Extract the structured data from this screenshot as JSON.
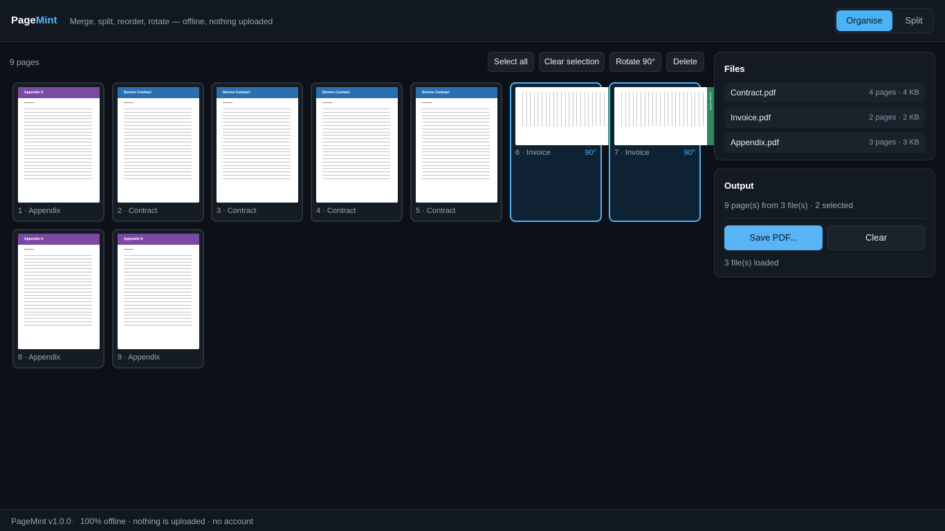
{
  "header": {
    "brand_part1": "Page",
    "brand_part2": "Mint",
    "tagline": "Merge, split, reorder, rotate — offline, nothing uploaded",
    "modes": [
      "Organise",
      "Split"
    ],
    "active_mode": "Organise"
  },
  "toolbar": {
    "page_count": "9 pages",
    "buttons": [
      "Select all",
      "Clear selection",
      "Rotate 90°",
      "Delete"
    ]
  },
  "thumbnails": {
    "appendix_header": "Appendix A",
    "contract_header": "Service Contract",
    "invoice_header": "Invoice #1042"
  },
  "pages": [
    {
      "label": "1 · Appendix",
      "kind": "appendix",
      "selected": false,
      "rotation": ""
    },
    {
      "label": "2 · Contract",
      "kind": "contract",
      "selected": false,
      "rotation": ""
    },
    {
      "label": "3 · Contract",
      "kind": "contract",
      "selected": false,
      "rotation": ""
    },
    {
      "label": "4 · Contract",
      "kind": "contract",
      "selected": false,
      "rotation": ""
    },
    {
      "label": "5 · Contract",
      "kind": "contract",
      "selected": false,
      "rotation": ""
    },
    {
      "label": "6 · Invoice",
      "kind": "invoice",
      "selected": true,
      "rotation": "90°"
    },
    {
      "label": "7 · Invoice",
      "kind": "invoice",
      "selected": true,
      "rotation": "90°"
    },
    {
      "label": "8 · Appendix",
      "kind": "appendix",
      "selected": false,
      "rotation": ""
    },
    {
      "label": "9 · Appendix",
      "kind": "appendix",
      "selected": false,
      "rotation": ""
    }
  ],
  "files_panel": {
    "title": "Files",
    "files": [
      {
        "name": "Contract.pdf",
        "meta": "4 pages · 4 KB"
      },
      {
        "name": "Invoice.pdf",
        "meta": "2 pages · 2 KB"
      },
      {
        "name": "Appendix.pdf",
        "meta": "3 pages · 3 KB"
      }
    ]
  },
  "output_panel": {
    "title": "Output",
    "summary": "9 page(s) from 3 file(s) · 2 selected",
    "save_label": "Save PDF...",
    "clear_label": "Clear",
    "loaded_text": "3 file(s) loaded"
  },
  "footer": {
    "version": "PageMint v1.0.0",
    "dot": "·",
    "status": "100% offline · nothing is uploaded · no account"
  },
  "colors": {
    "accent": "#4db2f5",
    "appendix_band": "#7b4aa3",
    "contract_band": "#2a6fb0",
    "invoice_band": "#2c8a5a"
  }
}
